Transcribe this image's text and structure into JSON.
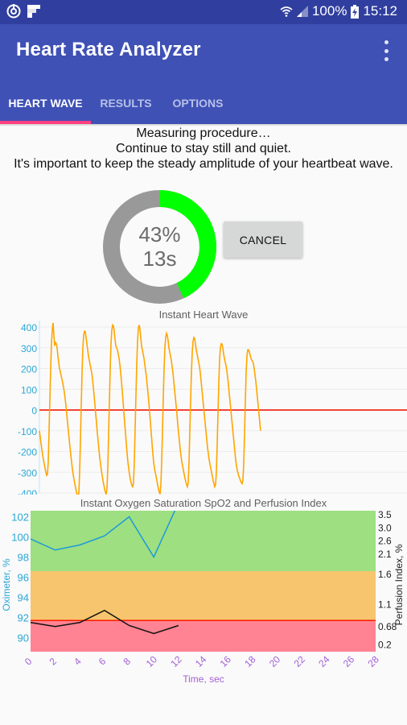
{
  "status_bar": {
    "left_icons": [
      "sync-target-icon",
      "flipboard-icon"
    ],
    "wifi_icon": "wifi-icon",
    "signal_icon": "signal-icon",
    "battery_percent": "100%",
    "battery_icon": "battery-charging-icon",
    "time": "15:12"
  },
  "app_bar": {
    "title": "Heart Rate Analyzer",
    "menu_icon": "more-vert-icon"
  },
  "tabs": [
    {
      "label": "HEART WAVE",
      "active": true
    },
    {
      "label": "RESULTS",
      "active": false
    },
    {
      "label": "OPTIONS",
      "active": false
    }
  ],
  "instructions": {
    "line1": "Measuring procedure…",
    "line2": "Continue to stay still and quiet.",
    "line3": "It's important to keep the steady amplitude of your heartbeat wave."
  },
  "progress": {
    "percent_label": "43%",
    "seconds_label": "13s",
    "fraction": 0.43,
    "fill_color": "#00ff00",
    "track_color": "#999999"
  },
  "cancel_button": {
    "label": "CANCEL"
  },
  "chart_data": [
    {
      "type": "line",
      "title": "Instant Heart Wave",
      "xlabel": "",
      "ylabel": "",
      "ylim": [
        -420,
        420
      ],
      "yticks": [
        "400",
        "300",
        "200",
        "100",
        "0",
        "-100",
        "-200",
        "-300",
        "-400"
      ],
      "ytick_values": [
        400,
        300,
        200,
        100,
        0,
        -100,
        -200,
        -300,
        -400
      ],
      "grid": true,
      "zero_line_color": "#f44336",
      "line_color": "#ffa500",
      "axis_color": "#29a7d6",
      "series": [
        {
          "name": "heart-wave",
          "x": [
            0,
            1,
            2,
            3,
            4,
            5,
            6,
            7,
            8,
            9,
            10,
            11,
            12,
            13,
            14,
            15,
            16,
            17,
            18,
            19,
            20,
            21,
            22,
            23,
            24,
            25,
            26,
            27,
            28,
            29,
            30,
            31,
            32,
            33,
            34,
            35,
            36,
            37,
            38,
            39,
            40,
            41,
            42,
            43,
            44,
            45,
            46,
            47,
            48,
            49,
            50,
            51,
            52,
            53,
            54,
            55,
            56,
            57,
            58,
            59,
            60,
            61,
            62,
            63,
            64,
            65,
            66,
            67,
            68,
            69,
            70,
            71,
            72,
            73,
            74,
            75,
            76,
            77,
            78,
            79,
            80,
            81,
            82,
            83,
            84,
            85,
            86,
            87,
            88,
            89,
            90,
            91,
            92,
            93,
            94,
            95,
            96,
            97,
            98,
            99,
            100,
            101,
            102,
            103,
            104,
            105,
            106,
            107,
            108,
            109,
            110,
            111,
            112,
            113,
            114,
            115,
            116,
            117,
            118,
            119,
            120,
            121,
            122,
            123,
            124,
            125,
            126,
            127,
            128,
            129,
            130,
            131,
            132,
            133,
            134,
            135,
            136,
            137,
            138,
            139,
            140,
            141,
            142,
            143,
            144,
            145,
            146,
            147,
            148,
            149,
            150,
            151,
            152,
            153,
            154,
            155,
            156,
            157,
            158,
            159,
            160,
            161,
            162,
            163,
            164,
            165,
            166,
            167,
            168,
            169,
            170,
            171,
            172,
            173,
            174,
            175,
            176,
            177,
            178,
            179,
            180,
            181,
            182,
            183,
            184,
            185,
            186,
            187,
            188,
            189,
            190,
            191,
            192,
            193,
            194,
            195,
            196,
            197,
            198,
            199,
            200,
            201,
            202,
            203,
            204,
            205,
            206,
            207,
            208,
            209,
            210,
            211,
            212,
            213,
            214,
            215,
            216,
            217,
            218,
            219,
            220,
            221,
            222,
            223,
            224,
            225,
            226,
            227,
            228,
            229,
            230,
            231,
            232,
            233,
            234,
            235,
            236,
            237,
            238,
            239,
            240,
            241,
            242,
            243,
            244,
            245,
            246,
            247,
            248,
            249,
            250,
            251,
            252,
            253,
            254,
            255,
            256,
            257,
            258,
            259,
            260,
            261,
            262,
            263,
            264,
            265,
            266,
            267,
            268,
            269,
            270,
            271,
            272,
            273,
            274,
            275,
            276,
            277,
            278,
            279,
            280,
            281,
            282,
            283,
            284,
            285,
            286,
            287,
            288,
            289,
            290,
            291,
            292,
            293,
            294,
            295,
            296,
            297,
            298,
            299,
            300,
            301,
            302,
            303,
            304,
            305,
            306,
            307,
            308,
            309,
            310,
            311,
            312,
            313,
            314,
            315,
            316,
            317,
            318,
            319,
            320,
            321,
            322,
            323,
            324,
            325,
            326,
            327,
            328,
            329,
            330,
            331,
            332,
            333,
            334,
            335,
            336,
            337,
            338,
            339,
            340,
            341,
            342,
            343,
            344,
            345,
            346,
            347,
            348,
            349,
            350,
            351,
            352,
            353,
            354,
            355,
            356,
            357,
            358,
            359,
            360,
            361,
            362,
            363,
            364,
            365,
            366,
            367,
            368,
            369,
            370,
            371,
            372,
            373,
            374,
            375,
            376,
            377,
            378,
            379,
            380,
            381,
            382,
            383,
            384,
            385,
            386,
            387,
            388,
            389,
            390,
            391,
            392,
            393
          ],
          "y": [
            -100,
            -130,
            -160,
            -190,
            -215,
            -240,
            -260,
            -280,
            -300,
            -315,
            -310,
            -250,
            -100,
            50,
            200,
            320,
            390,
            420,
            360,
            310,
            325,
            320,
            300,
            260,
            230,
            200,
            185,
            165,
            150,
            130,
            110,
            85,
            55,
            20,
            -20,
            -60,
            -100,
            -140,
            -180,
            -215,
            -250,
            -285,
            -310,
            -335,
            -355,
            -375,
            -395,
            -410,
            -418,
            -400,
            -300,
            -150,
            20,
            180,
            300,
            360,
            380,
            378,
            350,
            320,
            290,
            260,
            240,
            220,
            200,
            180,
            150,
            110,
            70,
            25,
            -20,
            -60,
            -110,
            -150,
            -190,
            -230,
            -260,
            -290,
            -315,
            -340,
            -360,
            -380,
            -395,
            -405,
            -380,
            -280,
            -120,
            40,
            200,
            320,
            385,
            410,
            405,
            380,
            340,
            310,
            300,
            290,
            270,
            250,
            220,
            180,
            140,
            90,
            40,
            -10,
            -60,
            -110,
            -160,
            -210,
            -250,
            -280,
            -310,
            -335,
            -350,
            -365,
            -370,
            -350,
            -250,
            -90,
            70,
            220,
            330,
            395,
            410,
            390,
            350,
            310,
            290,
            270,
            250,
            220,
            190,
            160,
            120,
            80,
            40,
            -10,
            -60,
            -110,
            -160,
            -210,
            -250,
            -280,
            -300,
            -320,
            -340,
            -360,
            -380,
            -395,
            -405,
            -360,
            -250,
            -100,
            60,
            200,
            300,
            350,
            370,
            360,
            335,
            300,
            280,
            260,
            240,
            210,
            180,
            140,
            100,
            60,
            20,
            -20,
            -70,
            -110,
            -150,
            -190,
            -220,
            -250,
            -270,
            -290,
            -310,
            -330,
            -345,
            -360,
            -370,
            -350,
            -250,
            -100,
            50,
            180,
            280,
            330,
            350,
            345,
            320,
            290,
            270,
            250,
            230,
            210,
            180,
            140,
            100,
            60,
            20,
            -20,
            -60,
            -100,
            -140,
            -180,
            -210,
            -240,
            -260,
            -280,
            -300,
            -320,
            -340,
            -355,
            -370,
            -360,
            -300,
            -170,
            -20,
            130,
            240,
            300,
            320,
            318,
            300,
            270,
            250,
            230,
            215,
            190,
            160,
            120,
            80,
            40,
            0,
            -40,
            -80,
            -120,
            -160,
            -200,
            -240,
            -270,
            -290,
            -305,
            -320,
            -330,
            -340,
            -350,
            -355,
            -340,
            -260,
            -120,
            40,
            180,
            260,
            290,
            290,
            280,
            265,
            250,
            240,
            235,
            225,
            200,
            170,
            140,
            100,
            60,
            20,
            -20,
            -60,
            -100
          ],
          "note": "values approximated from the drawn waveform"
        }
      ]
    },
    {
      "type": "line",
      "title": "Instant Oxygen Saturation SpO2 and Perfusion Index",
      "xlabel": "Time, sec",
      "ylabel_left": "Oximeter, %",
      "ylabel_right": "Perfusion Index, %",
      "xlim": [
        0,
        28
      ],
      "xticks": [
        "0",
        "2",
        "4",
        "6",
        "8",
        "10",
        "12",
        "14",
        "16",
        "18",
        "20",
        "22",
        "24",
        "26",
        "28"
      ],
      "xtick_values": [
        0,
        2,
        4,
        6,
        8,
        10,
        12,
        14,
        16,
        18,
        20,
        22,
        24,
        26,
        28
      ],
      "ylim_left": [
        88.6,
        102.6
      ],
      "yticks_left": [
        "102",
        "100",
        "98",
        "96",
        "94",
        "92",
        "90"
      ],
      "ytick_left_values": [
        102,
        100,
        98,
        96,
        94,
        92,
        90
      ],
      "yticks_right": [
        "3.5",
        "3.0",
        "2.6",
        "2.1",
        "1.6",
        "1.1",
        "0.68",
        "0.2"
      ],
      "ytick_right_positions_pct_left_axis": [
        102.2,
        100.9,
        99.6,
        98.3,
        96.3,
        93.3,
        91.1,
        89.3
      ],
      "bands": [
        {
          "name": "good",
          "from": 96.6,
          "to": 102.6,
          "color": "#9ddf81"
        },
        {
          "name": "warning",
          "from": 91.7,
          "to": 96.6,
          "color": "#f7c56e"
        },
        {
          "name": "low",
          "from": 88.6,
          "to": 91.7,
          "color": "#ff8392"
        }
      ],
      "threshold_line": {
        "value": 91.7,
        "color": "#ff1a00"
      },
      "series": [
        {
          "name": "SpO2",
          "color": "#1e9ad8",
          "x": [
            0,
            2,
            4,
            6,
            8,
            10,
            12
          ],
          "y": [
            99.8,
            98.7,
            99.2,
            100.1,
            102.0,
            98.0,
            103.4
          ]
        },
        {
          "name": "Perfusion Index",
          "color": "#111111",
          "x": [
            0,
            2,
            4,
            6,
            8,
            10,
            12
          ],
          "y": [
            91.5,
            91.1,
            91.5,
            92.7,
            91.2,
            90.4,
            91.2
          ]
        }
      ],
      "left_axis_color": "#29a7d6",
      "x_axis_color": "#a35fd6"
    }
  ]
}
